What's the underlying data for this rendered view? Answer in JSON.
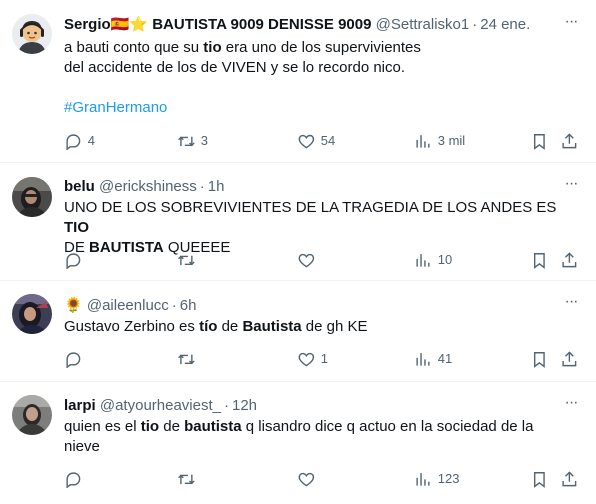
{
  "tweets": [
    {
      "name": "Sergio🇪🇸⭐ BAUTISTA 9009 DENISSE 9009",
      "handle": "@Settralisko1",
      "time": "24 ene.",
      "text_parts": [
        "a bauti conto que su ",
        "tio",
        " era uno de los supervivientes"
      ],
      "line2": "del accidente de los de VIVEN y se lo recordo nico.",
      "hashtag": "#GranHermano",
      "replies": "4",
      "retweets": "3",
      "likes": "54",
      "views": "3 mil",
      "avatar": "memoji-avatar"
    },
    {
      "name": "belu",
      "handle": "@erickshiness",
      "time": "1h",
      "line1_parts": [
        "UNO DE LOS SOBREVIVIENTES DE LA TRAGEDIA DE LOS ANDES ES ",
        "TIO"
      ],
      "line2_parts": [
        "DE ",
        "BAUTISTA",
        " QUEEEE"
      ],
      "replies": "",
      "retweets": "",
      "likes": "",
      "views": "10",
      "avatar": "photo-avatar"
    },
    {
      "name": "🌻",
      "handle": "@aileenlucc",
      "time": "6h",
      "text_parts": [
        "Gustavo Zerbino es ",
        "tío",
        " de ",
        "Bautista",
        " de gh KE"
      ],
      "replies": "",
      "retweets": "",
      "likes": "1",
      "views": "41",
      "avatar": "photo-avatar"
    },
    {
      "name": "larpi",
      "handle": "@atyourheaviest_",
      "time": "12h",
      "line1_parts": [
        "quien es el ",
        "tio",
        " de ",
        "bautista",
        " q lisandro dice q actuo en la sociedad de la"
      ],
      "line2": "nieve",
      "replies": "",
      "retweets": "",
      "likes": "",
      "views": "123",
      "avatar": "photo-avatar"
    }
  ],
  "colors": {
    "text": "#0f1419",
    "secondary": "#536471",
    "link": "#1d9bf0",
    "divider": "#eff3f4"
  },
  "icons": [
    "more-icon",
    "reply-icon",
    "retweet-icon",
    "like-icon",
    "views-icon",
    "bookmark-icon",
    "share-icon"
  ]
}
